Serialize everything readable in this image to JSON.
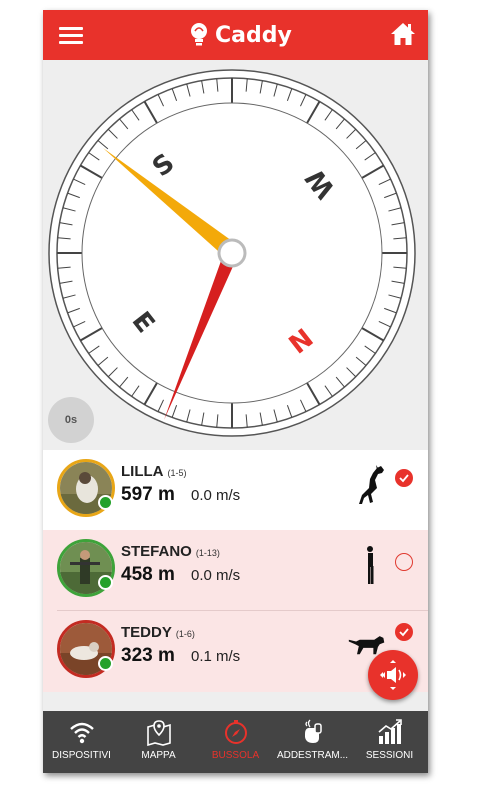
{
  "app": {
    "title": "Caddy",
    "accent": "#e8322b",
    "icons": {
      "menu": "hamburger-menu-icon",
      "logo": "lightbulb-logo-icon",
      "home": "home-icon"
    }
  },
  "compass": {
    "cardinals": {
      "north": "N",
      "east": "E",
      "south": "S",
      "west": "W"
    },
    "needle_north_color": "#d61f1f",
    "needle_target_color": "#f3a90a",
    "timer_label": "0s"
  },
  "dogs": [
    {
      "name": "LILLA",
      "range": "(1-5)",
      "distance": "597 m",
      "speed": "0.0 m/s",
      "posture": "dog-jumping-icon",
      "checked": true,
      "status_color": "#24a12b"
    },
    {
      "name": "STEFANO",
      "range": "(1-13)",
      "distance": "458 m",
      "speed": "0.0 m/s",
      "posture": "person-standing-icon",
      "checked": false,
      "status_color": "#24a12b"
    },
    {
      "name": "TEDDY",
      "range": "(1-6)",
      "distance": "323 m",
      "speed": "0.1 m/s",
      "posture": "dog-pointing-icon",
      "checked": true,
      "status_color": "#24a12b"
    }
  ],
  "fab": {
    "icon": "sound-beep-icon"
  },
  "nav": [
    {
      "label": "DISPOSITIVI",
      "icon": "wifi-signal-icon",
      "active": false
    },
    {
      "label": "MAPPA",
      "icon": "map-pin-icon",
      "active": false
    },
    {
      "label": "BUSSOLA",
      "icon": "compass-icon",
      "active": true
    },
    {
      "label": "ADDESTRAM...",
      "icon": "training-hand-icon",
      "active": false
    },
    {
      "label": "SESSIONI",
      "icon": "bar-chart-icon",
      "active": false
    }
  ]
}
